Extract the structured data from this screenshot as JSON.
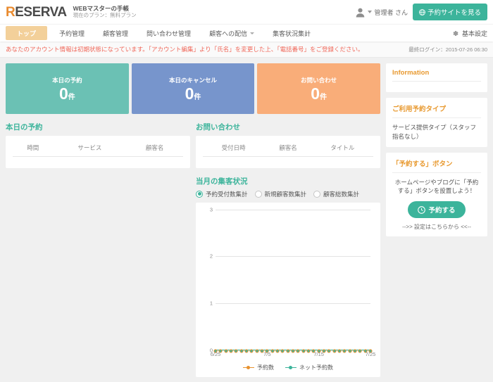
{
  "header": {
    "logo_text": "RESERVA",
    "logo_first_letter": "R",
    "logo_rest": "ESERVA",
    "brand_title": "WEBマスターの手帳",
    "brand_plan": "現在のプラン：無料プラン",
    "user_name": "管理者 さん",
    "avatar_icon": "user-avatar-icon",
    "caret_icon": "chevron-down-icon",
    "site_button_label": "予約サイトを見る",
    "site_button_icon": "globe-icon",
    "accent_teal": "#3cb49b",
    "accent_orange": "#e8992f"
  },
  "nav": {
    "items": [
      {
        "label": "トップ",
        "active": true,
        "has_caret": false
      },
      {
        "label": "予約管理",
        "active": false,
        "has_caret": false
      },
      {
        "label": "顧客管理",
        "active": false,
        "has_caret": false
      },
      {
        "label": "問い合わせ管理",
        "active": false,
        "has_caret": false
      },
      {
        "label": "顧客への配信",
        "active": false,
        "has_caret": true
      },
      {
        "label": "集客状況集計",
        "active": false,
        "has_caret": false
      }
    ],
    "settings_label": "基本設定",
    "settings_icon": "gear-icon"
  },
  "alert": {
    "message": "あなたのアカウント情報は初期状態になっています。「アカウント編集」より「氏名」を変更した上、「電話番号」をご登録ください。",
    "color": "#f0685a",
    "last_login": "最終ログイン：2015-07-26 06:30"
  },
  "stats": [
    {
      "label": "本日の予約",
      "value": "0",
      "unit": "件",
      "color": "#6bc1b4"
    },
    {
      "label": "本日のキャンセル",
      "value": "0",
      "unit": "件",
      "color": "#7795cc"
    },
    {
      "label": "お問い合わせ",
      "value": "0",
      "unit": "件",
      "color": "#f9ad79"
    }
  ],
  "today_reservations": {
    "title": "本日の予約",
    "columns": [
      "時間",
      "サービス",
      "顧客名"
    ],
    "rows": []
  },
  "inquiries": {
    "title": "お問い合わせ",
    "columns": [
      "受付日時",
      "顧客名",
      "タイトル"
    ],
    "rows": []
  },
  "monthly": {
    "title": "当月の集客状況",
    "radios": [
      {
        "label": "予約受付数集計",
        "selected": true
      },
      {
        "label": "新規顧客数集計",
        "selected": false
      },
      {
        "label": "顧客総数集計",
        "selected": false
      }
    ]
  },
  "chart_data": {
    "type": "line",
    "title": "当月の集客状況",
    "xlabel": "",
    "ylabel": "",
    "ylim": [
      0,
      3
    ],
    "yticks": [
      0,
      1,
      2,
      3
    ],
    "grid": true,
    "legend_position": "bottom",
    "x": [
      "6/25",
      "6/26",
      "6/27",
      "6/28",
      "6/29",
      "6/30",
      "7/1",
      "7/2",
      "7/3",
      "7/4",
      "7/5",
      "7/6",
      "7/7",
      "7/8",
      "7/9",
      "7/10",
      "7/11",
      "7/12",
      "7/13",
      "7/14",
      "7/15",
      "7/16",
      "7/17",
      "7/18",
      "7/19",
      "7/20",
      "7/21",
      "7/22",
      "7/23",
      "7/24",
      "7/25"
    ],
    "xtick_labels": [
      "6/25",
      "7/5",
      "7/15",
      "7/25"
    ],
    "xtick_indices": [
      0,
      10,
      20,
      30
    ],
    "series": [
      {
        "name": "予約数",
        "color": "#e8922f",
        "values": [
          0,
          0,
          0,
          0,
          0,
          0,
          0,
          0,
          0,
          0,
          0,
          0,
          0,
          0,
          0,
          0,
          0,
          0,
          0,
          0,
          0,
          0,
          0,
          0,
          0,
          0,
          0,
          0,
          0,
          0,
          0
        ]
      },
      {
        "name": "ネット予約数",
        "color": "#3cb49b",
        "values": [
          0,
          0,
          0,
          0,
          0,
          0,
          0,
          0,
          0,
          0,
          0,
          0,
          0,
          0,
          0,
          0,
          0,
          0,
          0,
          0,
          0,
          0,
          0,
          0,
          0,
          0,
          0,
          0,
          0,
          0,
          0
        ]
      }
    ]
  },
  "sidebar": {
    "information": {
      "title": "Information",
      "body": ""
    },
    "reservation_type": {
      "title": "ご利用予約タイプ",
      "body": "サービス提供タイプ（スタッフ指名なし）"
    },
    "reserve_button_card": {
      "title": "「予約する」ボタン",
      "body": "ホームページやブログに「予約する」ボタンを設置しよう！",
      "button_label": "予約する",
      "button_icon": "clock-icon",
      "link_text": "-->> 設定はこちらから <<--"
    }
  }
}
